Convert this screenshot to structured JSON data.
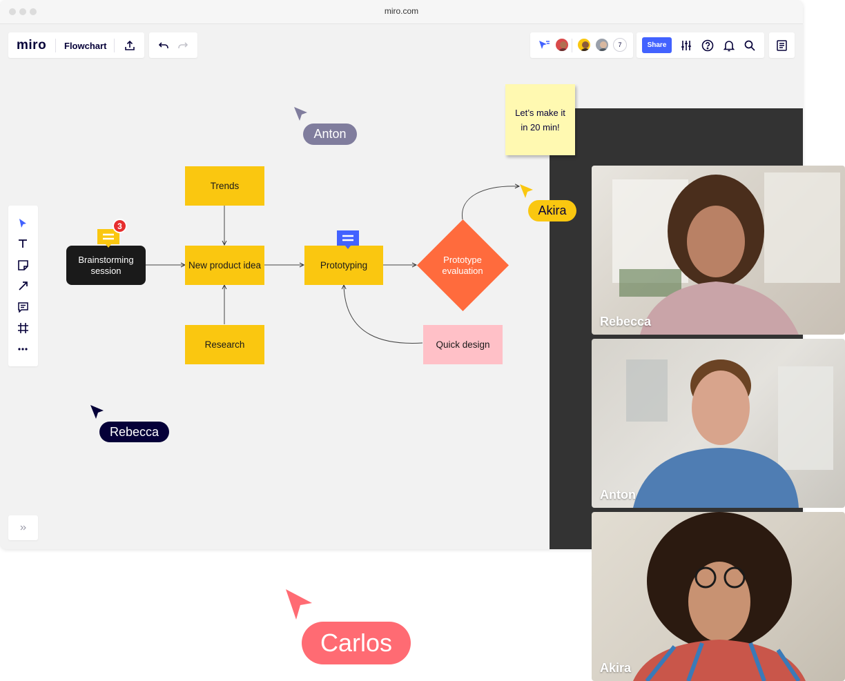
{
  "browser": {
    "url": "miro.com"
  },
  "header": {
    "logo": "miro",
    "board_name": "Flowchart",
    "participant_count": "7",
    "share_label": "Share"
  },
  "left_toolbar": {
    "tools": [
      "select-icon",
      "text-icon",
      "sticky-note-icon",
      "pen-icon",
      "comment-icon",
      "frame-icon",
      "more-icon"
    ]
  },
  "flowchart": {
    "trends": "Trends",
    "brainstorm_line1": "Brainstorming",
    "brainstorm_line2": "session",
    "new_product": "New product idea",
    "research": "Research",
    "prototyping": "Prototyping",
    "evaluation_line1": "Prototype",
    "evaluation_line2": "evaluation",
    "quick_design": "Quick design",
    "comment_badge": "3"
  },
  "sticky_note": {
    "line1": "Let’s make it",
    "line2": "in 20 min!"
  },
  "cursors": {
    "anton": "Anton",
    "akira": "Akira",
    "rebecca": "Rebecca",
    "carlos": "Carlos"
  },
  "video_call": [
    {
      "name": "Rebecca"
    },
    {
      "name": "Anton"
    },
    {
      "name": "Akira"
    }
  ],
  "colors": {
    "accent": "#4262ff",
    "sticky_yellow": "#fac710",
    "diamond_orange": "#ff6b3d",
    "pink": "#ffc0c7",
    "carlos": "#ff6b73",
    "akira": "#fac710",
    "anton": "#807d9d",
    "rebecca": "#050038"
  }
}
